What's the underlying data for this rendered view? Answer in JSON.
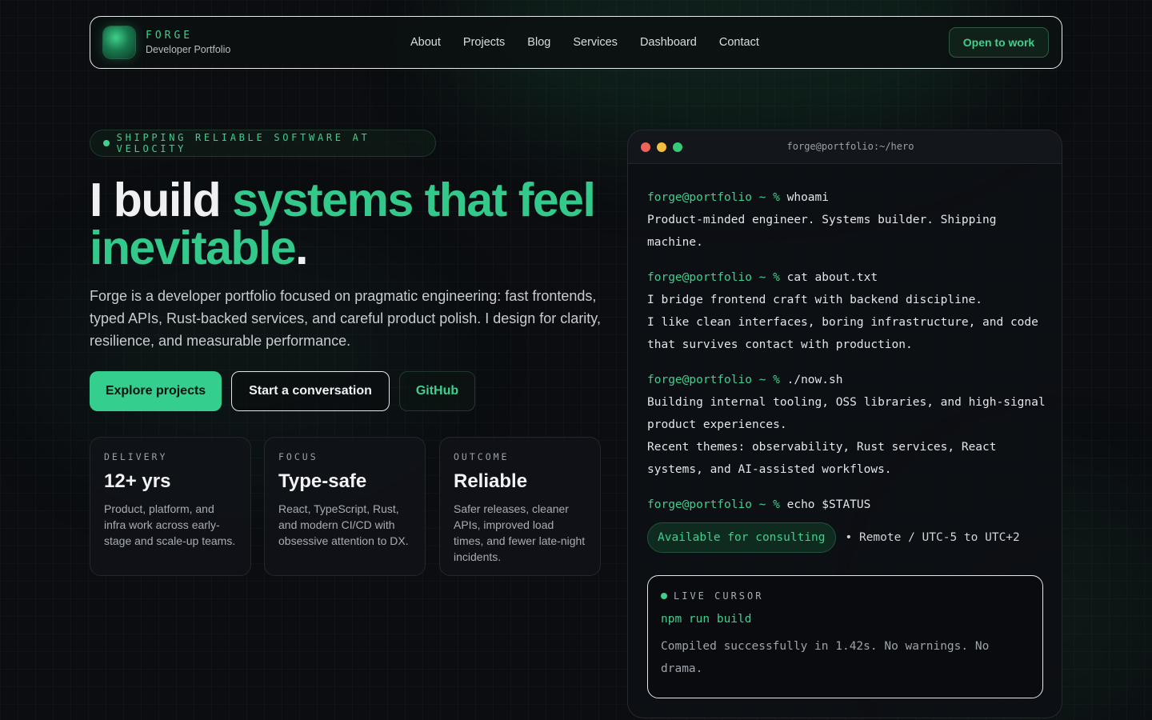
{
  "nav": {
    "brand_name": "FORGE",
    "brand_sub": "Developer Portfolio",
    "links": [
      "About",
      "Projects",
      "Blog",
      "Services",
      "Dashboard",
      "Contact"
    ],
    "cta": "Open to work"
  },
  "hero": {
    "pill": "SHIPPING RELIABLE SOFTWARE AT VELOCITY",
    "headline_white": "I build ",
    "headline_green": "systems that feel inevitable",
    "headline_end": ".",
    "lead": "Forge is a developer portfolio focused on pragmatic engineering: fast frontends, typed APIs, Rust-backed services, and careful product polish. I design for clarity, resilience, and measurable performance.",
    "buttons": {
      "primary": "Explore projects",
      "secondary": "Start a conversation",
      "ghost": "GitHub"
    },
    "cards": [
      {
        "kicker": "DELIVERY",
        "title": "12+ yrs",
        "body": "Product, platform, and infra work across early-stage and scale-up teams."
      },
      {
        "kicker": "FOCUS",
        "title": "Type-safe",
        "body": "React, TypeScript, Rust, and modern CI/CD with obsessive attention to DX."
      },
      {
        "kicker": "OUTCOME",
        "title": "Reliable",
        "body": "Safer releases, cleaner APIs, improved load times, and fewer late-night incidents."
      }
    ]
  },
  "terminal": {
    "title": "forge@portfolio:~/hero",
    "prompt": "forge@portfolio ~ %",
    "blocks": [
      {
        "cmd": "whoami",
        "out": [
          "Product-minded engineer. Systems builder. Shipping machine."
        ]
      },
      {
        "cmd": "cat about.txt",
        "out": [
          "I bridge frontend craft with backend discipline.",
          "I like clean interfaces, boring infrastructure, and code that survives contact with production."
        ]
      },
      {
        "cmd": "./now.sh",
        "out": [
          "Building internal tooling, OSS libraries, and high-signal product experiences.",
          "Recent themes: observability, Rust services, React systems, and AI-assisted workflows."
        ]
      },
      {
        "cmd": "echo $STATUS",
        "out": []
      }
    ],
    "status_badge": "Available for consulting",
    "status_meta": "• Remote / UTC-5 to UTC+2",
    "live": {
      "label": "LIVE CURSOR",
      "cmd": "npm run build",
      "out": "Compiled successfully in 1.42s. No warnings. No drama."
    }
  },
  "colors": {
    "accent": "#3fcf8e",
    "background": "#0b0d10"
  }
}
